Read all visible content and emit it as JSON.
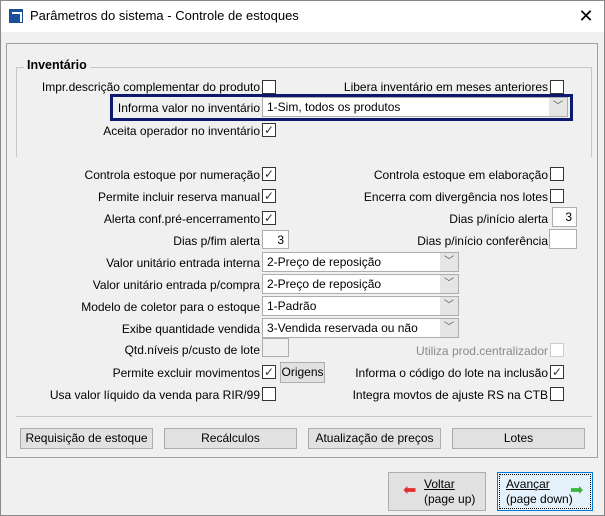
{
  "window": {
    "title": "Parâmetros do sistema - Controle de estoques",
    "close_label": "✕"
  },
  "inventario": {
    "title": "Inventário",
    "impr_descricao": {
      "label": "Impr.descrição complementar do produto",
      "checked": false
    },
    "libera_inventario": {
      "label": "Libera inventário em meses anteriores",
      "checked": false
    },
    "informa_valor": {
      "label": "Informa valor no inventário",
      "value": "1-Sim, todos os produtos"
    },
    "aceita_operador": {
      "label": "Aceita operador no inventário",
      "checked": true
    }
  },
  "params": {
    "controla_numeracao": {
      "label": "Controla estoque por numeração",
      "checked": true
    },
    "controla_elaboracao": {
      "label": "Controla estoque em elaboração",
      "checked": false
    },
    "reserva_manual": {
      "label": "Permite incluir reserva manual",
      "checked": true
    },
    "encerra_divergencia": {
      "label": "Encerra com divergência nos lotes",
      "checked": false
    },
    "alerta_pre": {
      "label": "Alerta conf.pré-encerramento",
      "checked": true
    },
    "dias_inicio_alerta": {
      "label": "Dias p/início alerta",
      "value": "3"
    },
    "dias_fim_alerta": {
      "label": "Dias p/fim alerta",
      "value": "3"
    },
    "dias_inicio_conf": {
      "label": "Dias p/início conferência",
      "value": ""
    },
    "valor_interna": {
      "label": "Valor unitário entrada interna",
      "value": "2-Preço de reposição"
    },
    "valor_compra": {
      "label": "Valor unitário entrada p/compra",
      "value": "2-Preço de reposição"
    },
    "modelo_coletor": {
      "label": "Modelo de coletor para o estoque",
      "value": "1-Padrão"
    },
    "qtd_vendida": {
      "label": "Exibe quantidade vendida",
      "value": "3-Vendida reservada ou não"
    },
    "qtd_niveis": {
      "label": "Qtd.níveis p/custo de lote",
      "value": ""
    },
    "prod_centralizador": {
      "label": "Utiliza prod.centralizador",
      "checked": false,
      "disabled": true
    },
    "excluir_mov": {
      "label": "Permite excluir movimentos",
      "checked": true
    },
    "origens_label": "Origens",
    "codigo_lote": {
      "label": "Informa o código do lote na inclusão",
      "checked": true
    },
    "valor_liquido": {
      "label": "Usa valor líquido da venda para RIR/99",
      "checked": false
    },
    "integra_movtos": {
      "label": "Integra movtos de ajuste RS na CTB",
      "checked": false
    }
  },
  "buttons": {
    "requisicao": "Requisição de estoque",
    "recalculos": "Recálculos",
    "atualizacao": "Atualização de preços",
    "lotes": "Lotes"
  },
  "nav": {
    "back_line1": "Voltar",
    "back_line2": "(page up)",
    "next_line1": "Avançar",
    "next_line2": "(page down)"
  },
  "colors": {
    "highlight": "#0c1a6e",
    "back_arrow": "#e03030",
    "next_arrow": "#3cb43c"
  }
}
